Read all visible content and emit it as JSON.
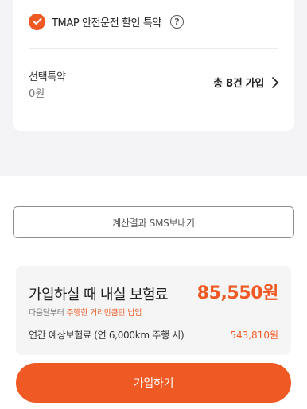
{
  "options": {
    "rider_label": "TMAP 안전운전 할인 특약",
    "help_symbol": "?",
    "selected_title": "선택특약",
    "selected_price": "0원",
    "total_label": "총 8건 가입"
  },
  "actions": {
    "sms_label": "계산결과 SMS보내기",
    "join_label": "가입하기"
  },
  "summary": {
    "title": "가입하실 때 내실 보험료",
    "amount": "85,550원",
    "note_prefix": "다음달부터",
    "note_highlight": "주행한 거리만큼만 납입",
    "annual_label": "연간 예상보험료 (연 6,000km 주행 시)",
    "annual_value": "543,810원"
  },
  "colors": {
    "accent": "#ef5a24",
    "background": "#f4f4f6"
  }
}
